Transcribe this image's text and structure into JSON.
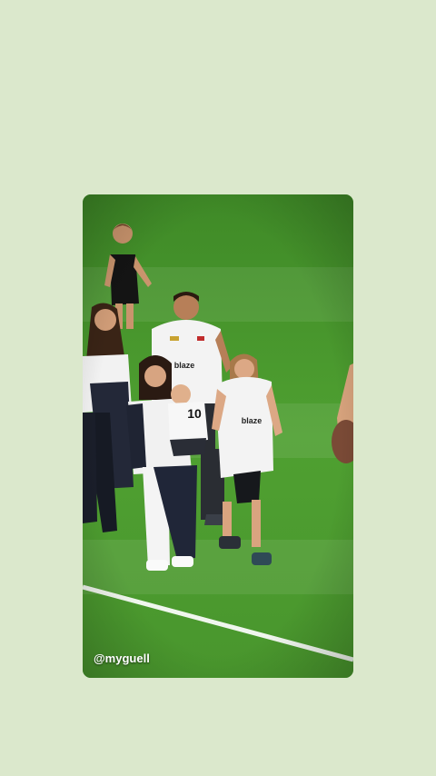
{
  "story": {
    "watermark": "@myguell",
    "sponsor_logo": "blaze",
    "child_shirt_number": "10"
  },
  "colors": {
    "background": "#dbe8cc",
    "pitch": "#4c9a2e",
    "pitch_line": "#ffffff",
    "jersey": "#f3f3f3",
    "dark": "#1d2230"
  }
}
